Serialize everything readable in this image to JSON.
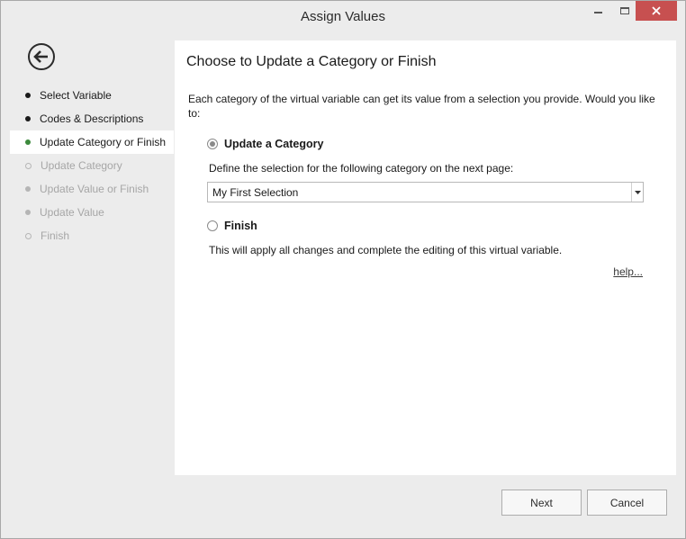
{
  "window": {
    "title": "Assign Values",
    "controls": {
      "minimize_icon": "minimize-icon",
      "maximize_icon": "maximize-icon",
      "close_icon": "close-icon",
      "close_color": "#c75050"
    }
  },
  "sidebar": {
    "back_icon": "back-arrow-icon",
    "items": [
      {
        "label": "Select Variable",
        "state": "done"
      },
      {
        "label": "Codes & Descriptions",
        "state": "done"
      },
      {
        "label": "Update Category or Finish",
        "state": "current"
      },
      {
        "label": "Update Category",
        "state": "disabled"
      },
      {
        "label": "Update Value or Finish",
        "state": "disabled"
      },
      {
        "label": "Update Value",
        "state": "disabled"
      },
      {
        "label": "Finish",
        "state": "disabled"
      }
    ],
    "current_color": "#3c8a3c"
  },
  "main": {
    "heading": "Choose to Update a Category or Finish",
    "intro": "Each category of the virtual variable can get its value from a selection you provide. Would you like to:",
    "option_update": {
      "label": "Update a Category",
      "selected": true,
      "description": "Define the selection for the following category on the next page:",
      "select_value": "My First Selection"
    },
    "option_finish": {
      "label": "Finish",
      "selected": false,
      "description": "This will apply all changes and complete the editing of this virtual variable."
    },
    "help_link": "help..."
  },
  "footer": {
    "next_label": "Next",
    "cancel_label": "Cancel"
  }
}
